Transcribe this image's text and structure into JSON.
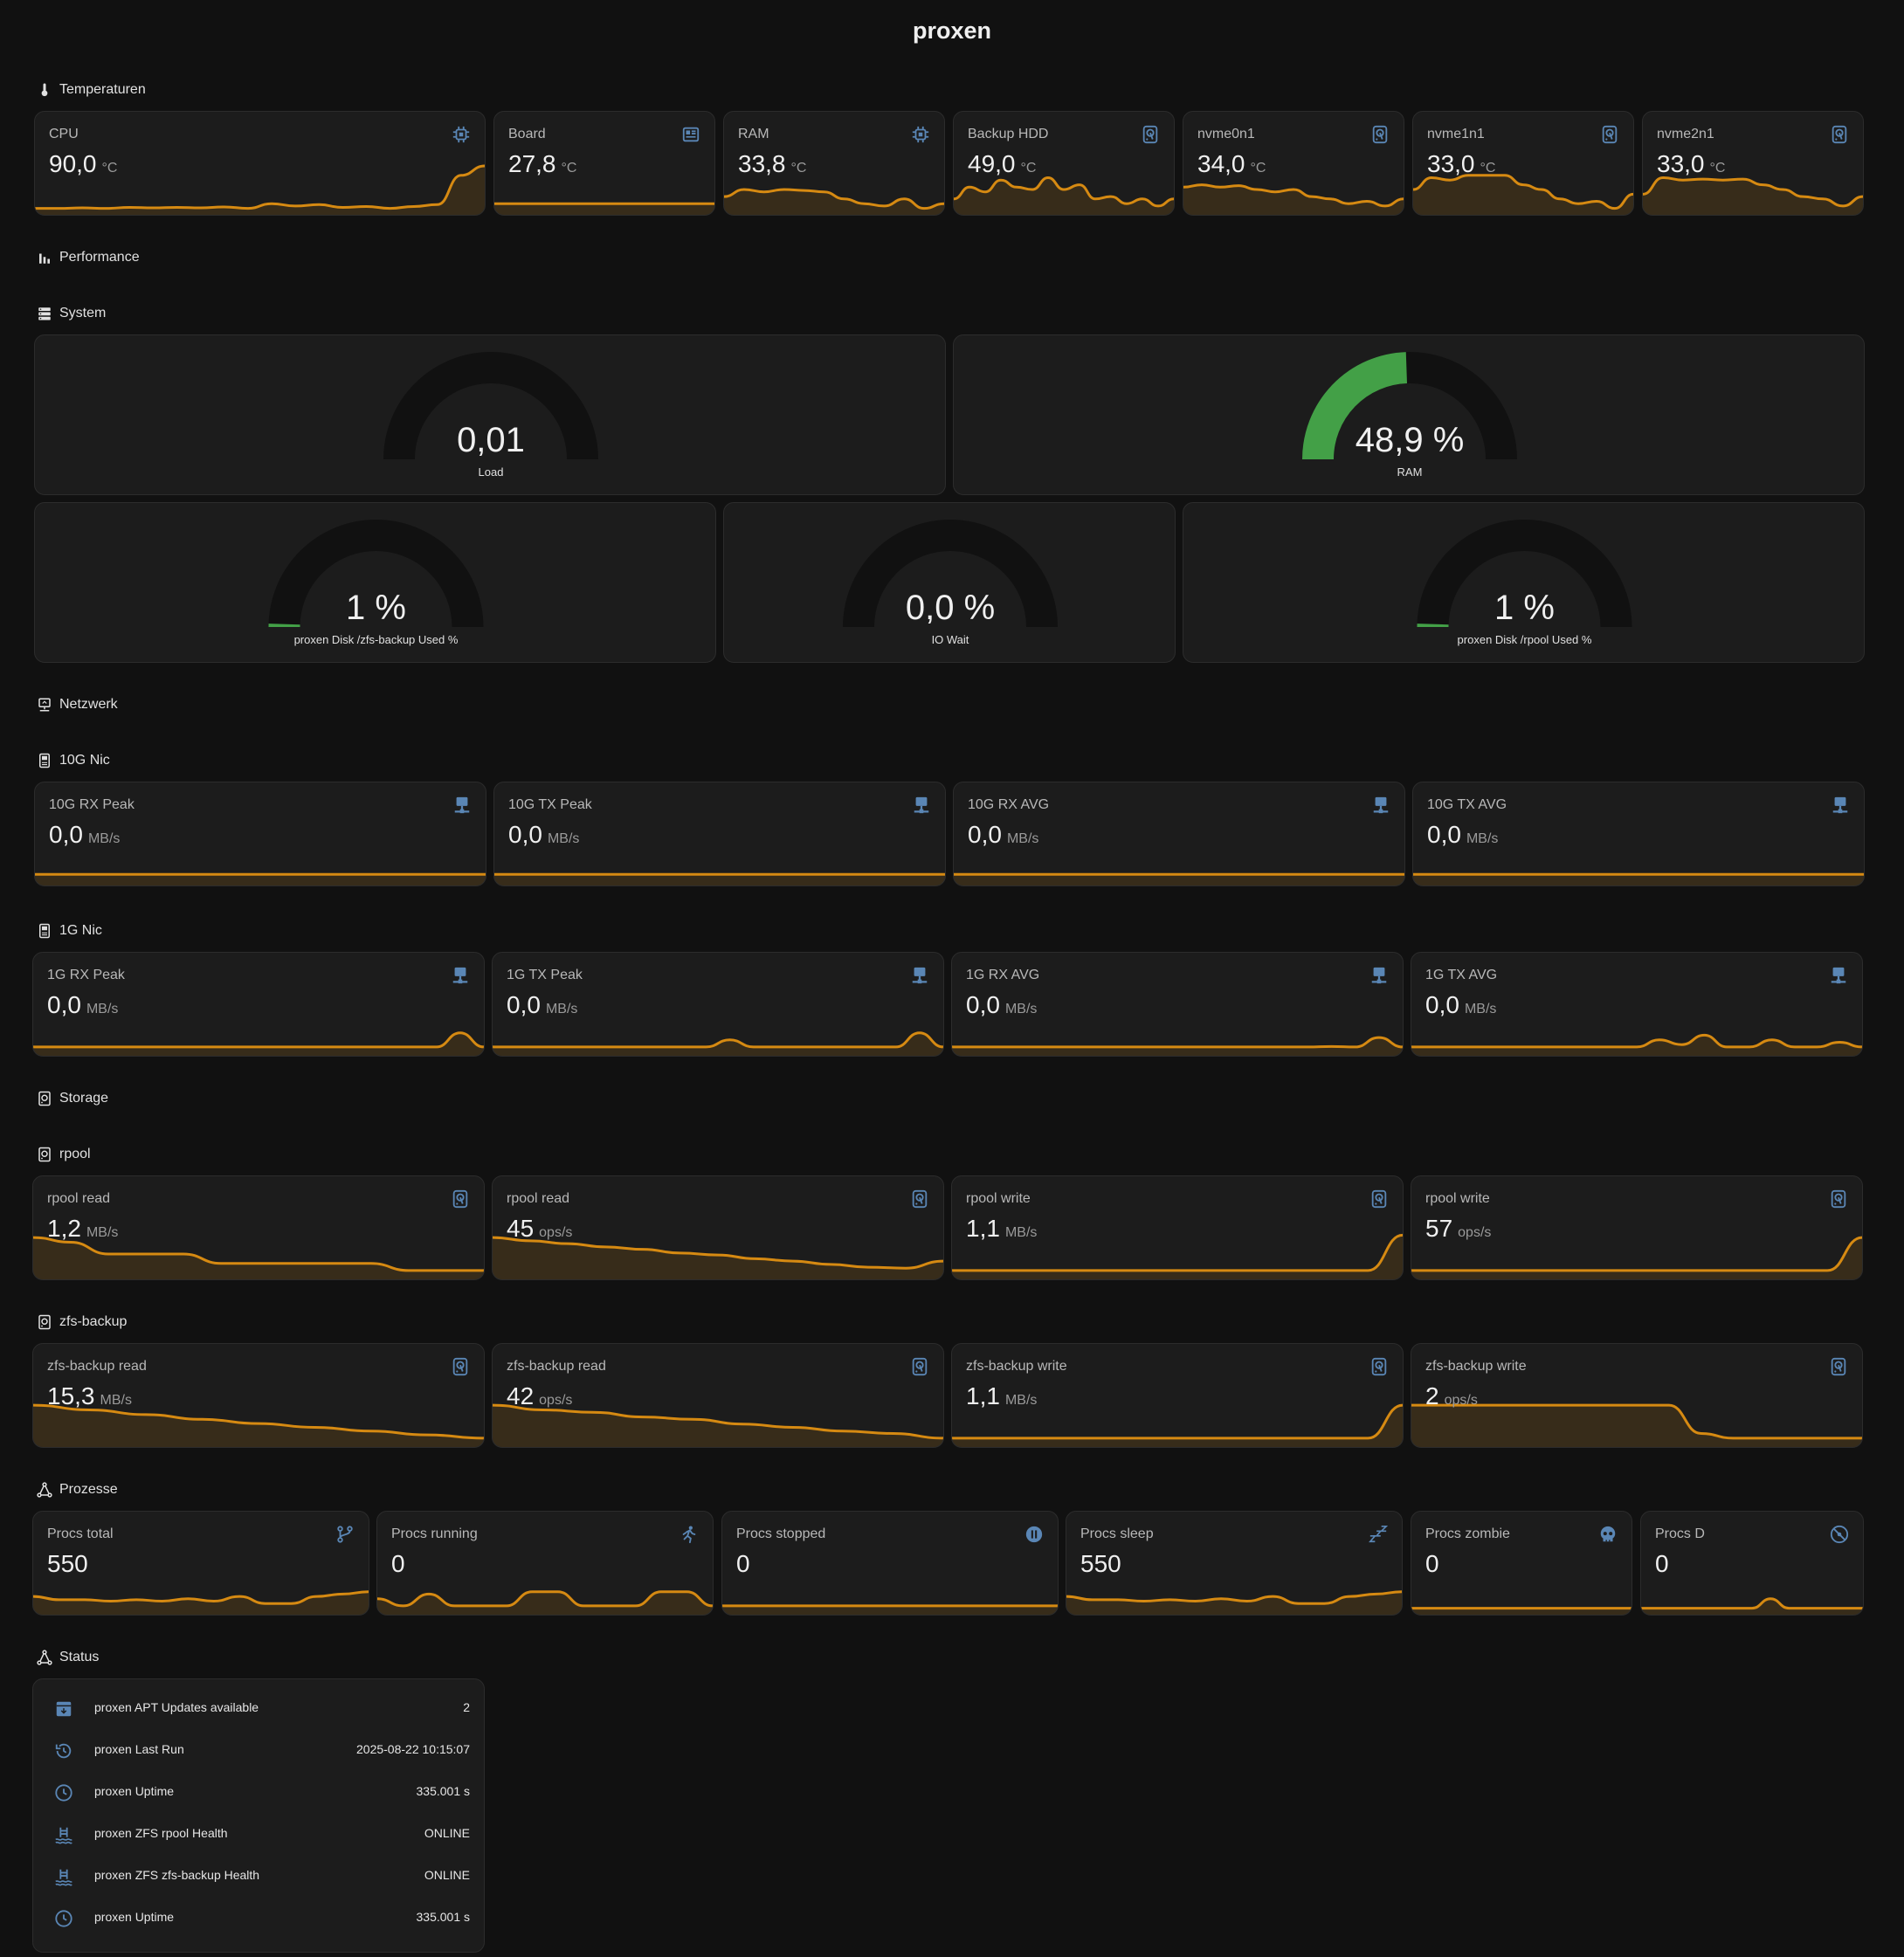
{
  "title": "proxen",
  "sections": {
    "temperatures": "Temperaturen",
    "performance": "Performance",
    "system": "System",
    "network": "Netzwerk",
    "nic10g": "10G Nic",
    "nic1g": "1G Nic",
    "storage": "Storage",
    "rpool": "rpool",
    "zfs_backup": "zfs-backup",
    "processes": "Prozesse",
    "status": "Status"
  },
  "colors": {
    "accent": "#d68a12",
    "gauge_fill": "#43a047",
    "gauge_track": "#111111",
    "icon": "#5a86b5"
  },
  "temperatures": [
    {
      "name": "CPU",
      "value": "90,0",
      "unit": "°C",
      "icon": "chip-icon",
      "trend": [
        0.1,
        0.1,
        0.11,
        0.1,
        0.12,
        0.11,
        0.12,
        0.11,
        0.13,
        0.1,
        0.2,
        0.15,
        0.18,
        0.12,
        0.14,
        0.1,
        0.14,
        0.18,
        0.8,
        1.0
      ]
    },
    {
      "name": "Board",
      "value": "27,8",
      "unit": "°C",
      "icon": "board-icon",
      "trend": [
        0.2,
        0.2,
        0.2,
        0.2,
        0.2,
        0.2,
        0.2,
        0.2,
        0.2,
        0.2
      ]
    },
    {
      "name": "RAM",
      "value": "33,8",
      "unit": "°C",
      "icon": "chip-icon",
      "trend": [
        0.35,
        0.5,
        0.45,
        0.5,
        0.48,
        0.45,
        0.3,
        0.2,
        0.15,
        0.3,
        0.1,
        0.2
      ]
    },
    {
      "name": "Backup HDD",
      "value": "49,0",
      "unit": "°C",
      "icon": "harddisk-icon",
      "trend": [
        0.3,
        0.55,
        0.45,
        0.7,
        0.55,
        0.5,
        0.75,
        0.5,
        0.6,
        0.3,
        0.35,
        0.2,
        0.3,
        0.15,
        0.3
      ]
    },
    {
      "name": "nvme0n1",
      "value": "34,0",
      "unit": "°C",
      "icon": "harddisk-icon",
      "trend": [
        0.55,
        0.6,
        0.55,
        0.58,
        0.5,
        0.45,
        0.5,
        0.35,
        0.3,
        0.2,
        0.25,
        0.15,
        0.3
      ]
    },
    {
      "name": "nvme1n1",
      "value": "33,0",
      "unit": "°C",
      "icon": "harddisk-icon",
      "trend": [
        0.5,
        0.75,
        0.7,
        0.8,
        0.8,
        0.8,
        0.6,
        0.5,
        0.3,
        0.2,
        0.25,
        0.1,
        0.4
      ]
    },
    {
      "name": "nvme2n1",
      "value": "33,0",
      "unit": "°C",
      "icon": "harddisk-icon",
      "trend": [
        0.4,
        0.75,
        0.7,
        0.72,
        0.7,
        0.72,
        0.6,
        0.5,
        0.35,
        0.3,
        0.15,
        0.35
      ]
    }
  ],
  "gauges": [
    {
      "label": "Load",
      "value": "0,01",
      "fraction": 0.0
    },
    {
      "label": "RAM",
      "value": "48,9 %",
      "fraction": 0.489
    },
    {
      "label": "proxen Disk /zfs-backup Used %",
      "value": "1 %",
      "fraction": 0.01
    },
    {
      "label": "IO Wait",
      "value": "0,0 %",
      "fraction": 0.0
    },
    {
      "label": "proxen Disk /rpool Used %",
      "value": "1 %",
      "fraction": 0.01
    }
  ],
  "nic10g": [
    {
      "name": "10G RX Peak",
      "value": "0,0",
      "unit": "MB/s",
      "icon": "network-icon",
      "trend": [
        0.2,
        0.2,
        0.2,
        0.2,
        0.2
      ]
    },
    {
      "name": "10G TX Peak",
      "value": "0,0",
      "unit": "MB/s",
      "icon": "network-icon",
      "trend": [
        0.2,
        0.2,
        0.2,
        0.2,
        0.2
      ]
    },
    {
      "name": "10G RX AVG",
      "value": "0,0",
      "unit": "MB/s",
      "icon": "network-icon",
      "trend": [
        0.2,
        0.2,
        0.2,
        0.2,
        0.2
      ]
    },
    {
      "name": "10G TX AVG",
      "value": "0,0",
      "unit": "MB/s",
      "icon": "network-icon",
      "trend": [
        0.2,
        0.2,
        0.2,
        0.2,
        0.2
      ]
    }
  ],
  "nic1g": [
    {
      "name": "1G RX Peak",
      "value": "0,0",
      "unit": "MB/s",
      "icon": "network-icon",
      "trend": [
        0.15,
        0.15,
        0.15,
        0.15,
        0.15,
        0.15,
        0.15,
        0.15,
        0.15,
        0.15,
        0.15,
        0.15,
        0.15,
        0.15,
        0.15,
        0.15,
        0.15,
        0.15,
        0.45,
        0.15
      ]
    },
    {
      "name": "1G TX Peak",
      "value": "0,0",
      "unit": "MB/s",
      "icon": "network-icon",
      "trend": [
        0.15,
        0.15,
        0.15,
        0.15,
        0.15,
        0.15,
        0.15,
        0.15,
        0.15,
        0.15,
        0.3,
        0.15,
        0.15,
        0.15,
        0.15,
        0.15,
        0.15,
        0.15,
        0.45,
        0.15
      ]
    },
    {
      "name": "1G RX AVG",
      "value": "0,0",
      "unit": "MB/s",
      "icon": "network-icon",
      "trend": [
        0.15,
        0.15,
        0.15,
        0.15,
        0.15,
        0.15,
        0.15,
        0.15,
        0.15,
        0.15,
        0.15,
        0.15,
        0.15,
        0.15,
        0.15,
        0.15,
        0.16,
        0.15,
        0.35,
        0.15
      ]
    },
    {
      "name": "1G TX AVG",
      "value": "0,0",
      "unit": "MB/s",
      "icon": "network-icon",
      "trend": [
        0.15,
        0.15,
        0.15,
        0.15,
        0.15,
        0.15,
        0.15,
        0.15,
        0.15,
        0.15,
        0.15,
        0.3,
        0.2,
        0.4,
        0.15,
        0.15,
        0.3,
        0.15,
        0.15,
        0.25,
        0.15
      ]
    }
  ],
  "rpool": [
    {
      "name": "rpool read",
      "value": "1,2",
      "unit": "MB/s",
      "icon": "harddisk-icon",
      "trend": [
        0.85,
        0.75,
        0.5,
        0.5,
        0.5,
        0.3,
        0.3,
        0.3,
        0.3,
        0.3,
        0.15,
        0.15,
        0.15
      ]
    },
    {
      "name": "rpool read",
      "value": "45",
      "unit": "ops/s",
      "icon": "harddisk-icon",
      "trend": [
        0.85,
        0.78,
        0.72,
        0.65,
        0.6,
        0.52,
        0.48,
        0.4,
        0.35,
        0.28,
        0.22,
        0.2,
        0.35
      ]
    },
    {
      "name": "rpool write",
      "value": "1,1",
      "unit": "MB/s",
      "icon": "harddisk-icon",
      "trend": [
        0.15,
        0.15,
        0.15,
        0.15,
        0.15,
        0.15,
        0.15,
        0.15,
        0.15,
        0.15,
        0.15,
        0.15,
        0.15,
        0.9
      ]
    },
    {
      "name": "rpool write",
      "value": "57",
      "unit": "ops/s",
      "icon": "harddisk-icon",
      "trend": [
        0.15,
        0.15,
        0.15,
        0.15,
        0.15,
        0.15,
        0.15,
        0.15,
        0.15,
        0.15,
        0.15,
        0.15,
        0.15,
        0.85
      ]
    }
  ],
  "zfs_backup": [
    {
      "name": "zfs-backup read",
      "value": "15,3",
      "unit": "MB/s",
      "icon": "harddisk-icon",
      "trend": [
        0.85,
        0.75,
        0.65,
        0.55,
        0.46,
        0.38,
        0.3,
        0.22,
        0.15
      ]
    },
    {
      "name": "zfs-backup read",
      "value": "42",
      "unit": "ops/s",
      "icon": "harddisk-icon",
      "trend": [
        0.85,
        0.75,
        0.7,
        0.6,
        0.55,
        0.45,
        0.38,
        0.3,
        0.25,
        0.15
      ]
    },
    {
      "name": "zfs-backup write",
      "value": "1,1",
      "unit": "MB/s",
      "icon": "harddisk-icon",
      "trend": [
        0.15,
        0.15,
        0.15,
        0.15,
        0.15,
        0.15,
        0.15,
        0.15,
        0.15,
        0.15,
        0.15,
        0.15,
        0.15,
        0.85
      ]
    },
    {
      "name": "zfs-backup write",
      "value": "2",
      "unit": "ops/s",
      "icon": "harddisk-icon",
      "trend": [
        0.85,
        0.85,
        0.85,
        0.85,
        0.85,
        0.85,
        0.85,
        0.85,
        0.85,
        0.25,
        0.15,
        0.15,
        0.15,
        0.15,
        0.15
      ]
    }
  ],
  "processes": [
    {
      "name": "Procs total",
      "value": "550",
      "unit": "",
      "icon": "fork-icon",
      "trend": [
        0.35,
        0.28,
        0.28,
        0.25,
        0.28,
        0.25,
        0.3,
        0.25,
        0.35,
        0.2,
        0.2,
        0.35,
        0.4,
        0.45
      ]
    },
    {
      "name": "Procs running",
      "value": "0",
      "unit": "",
      "icon": "run-icon",
      "trend": [
        0.3,
        0.15,
        0.4,
        0.15,
        0.15,
        0.15,
        0.45,
        0.45,
        0.15,
        0.15,
        0.15,
        0.45,
        0.45,
        0.15
      ]
    },
    {
      "name": "Procs stopped",
      "value": "0",
      "unit": "",
      "icon": "pause-icon",
      "trend": [
        0.15,
        0.15,
        0.15,
        0.15,
        0.15
      ]
    },
    {
      "name": "Procs sleep",
      "value": "550",
      "unit": "",
      "icon": "sleep-icon",
      "trend": [
        0.35,
        0.28,
        0.28,
        0.25,
        0.28,
        0.25,
        0.3,
        0.25,
        0.35,
        0.2,
        0.2,
        0.35,
        0.4,
        0.45
      ]
    },
    {
      "name": "Procs zombie",
      "value": "0",
      "unit": "",
      "icon": "skull-icon",
      "trend": [
        0.1,
        0.1,
        0.1,
        0.1,
        0.1
      ]
    },
    {
      "name": "Procs D",
      "value": "0",
      "unit": "",
      "icon": "disc-icon",
      "trend": [
        0.1,
        0.1,
        0.1,
        0.1,
        0.1,
        0.1,
        0.1,
        0.3,
        0.1,
        0.1,
        0.1,
        0.1,
        0.1
      ]
    }
  ],
  "status": [
    {
      "label": "proxen APT Updates available",
      "value": "2",
      "icon": "package-icon"
    },
    {
      "label": "proxen Last Run",
      "value": "2025-08-22 10:15:07",
      "icon": "history-icon"
    },
    {
      "label": "proxen Uptime",
      "value": "335.001 s",
      "icon": "clock-icon"
    },
    {
      "label": "proxen ZFS rpool Health",
      "value": "ONLINE",
      "icon": "pool-icon"
    },
    {
      "label": "proxen ZFS zfs-backup Health",
      "value": "ONLINE",
      "icon": "pool-icon"
    },
    {
      "label": "proxen Uptime",
      "value": "335.001 s",
      "icon": "clock-icon"
    }
  ]
}
